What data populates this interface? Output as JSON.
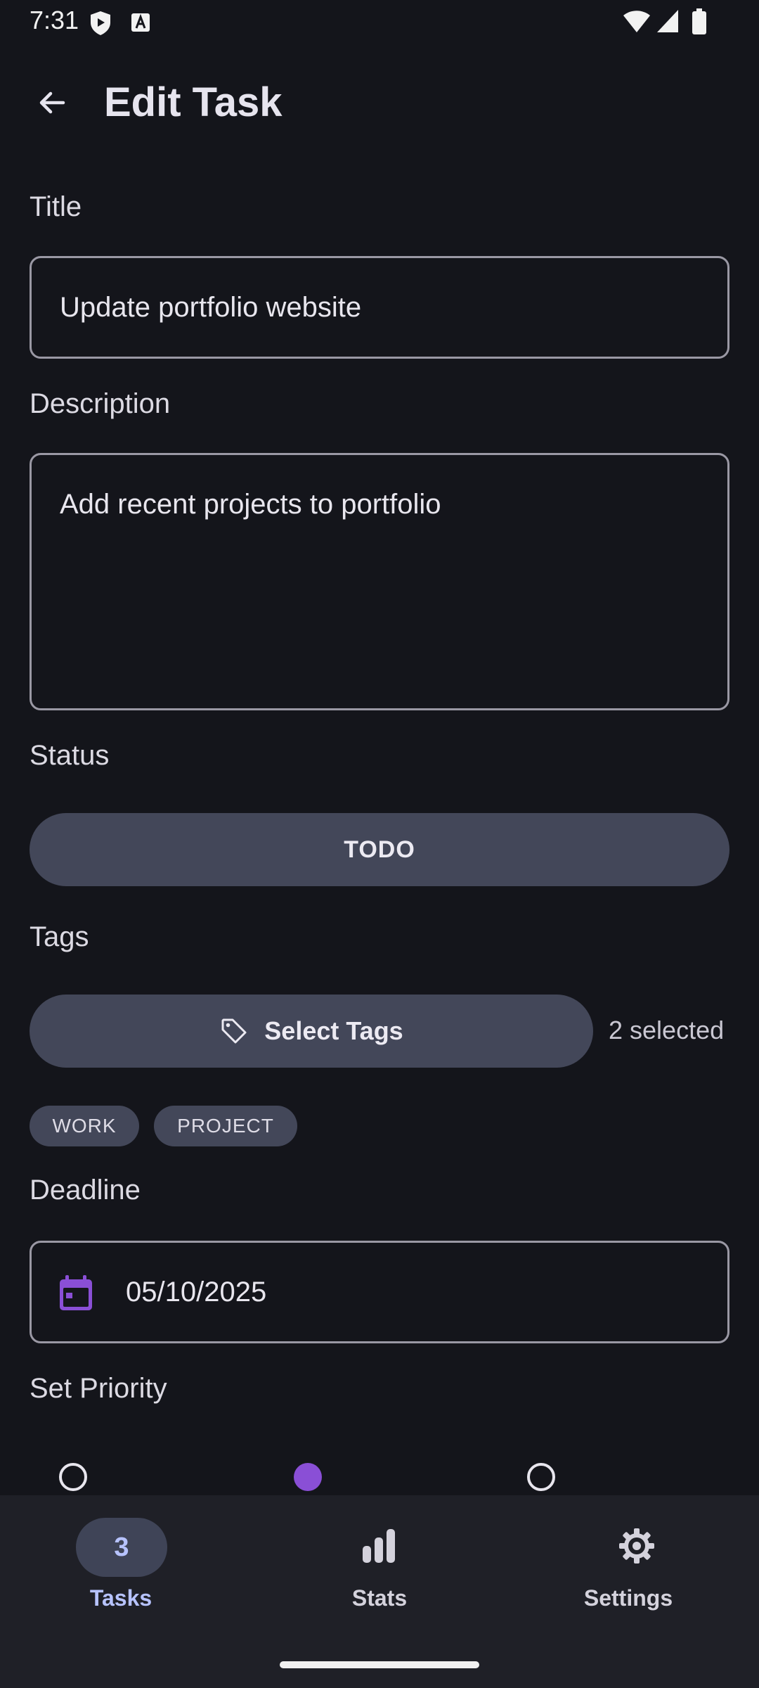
{
  "status_bar": {
    "time": "7:31"
  },
  "header": {
    "title": "Edit Task"
  },
  "form": {
    "title_label": "Title",
    "title_value": "Update portfolio website",
    "description_label": "Description",
    "description_value": "Add recent projects to portfolio",
    "status_label": "Status",
    "status_value": "TODO",
    "tags_label": "Tags",
    "select_tags_label": "Select Tags",
    "selected_count": "2 selected",
    "tags": [
      "WORK",
      "PROJECT"
    ],
    "deadline_label": "Deadline",
    "deadline_value": "05/10/2025",
    "priority_label": "Set Priority"
  },
  "bottom_nav": {
    "items": [
      {
        "label": "Tasks",
        "badge": "3",
        "active": true
      },
      {
        "label": "Stats",
        "icon": "bar-chart-icon",
        "active": false
      },
      {
        "label": "Settings",
        "icon": "gear-icon",
        "active": false
      }
    ]
  },
  "colors": {
    "background": "#14151b",
    "accent": "#b7c3ff",
    "pill": "#434759",
    "calendar_icon": "#8a4fd6",
    "nav_background": "#1f2027"
  }
}
